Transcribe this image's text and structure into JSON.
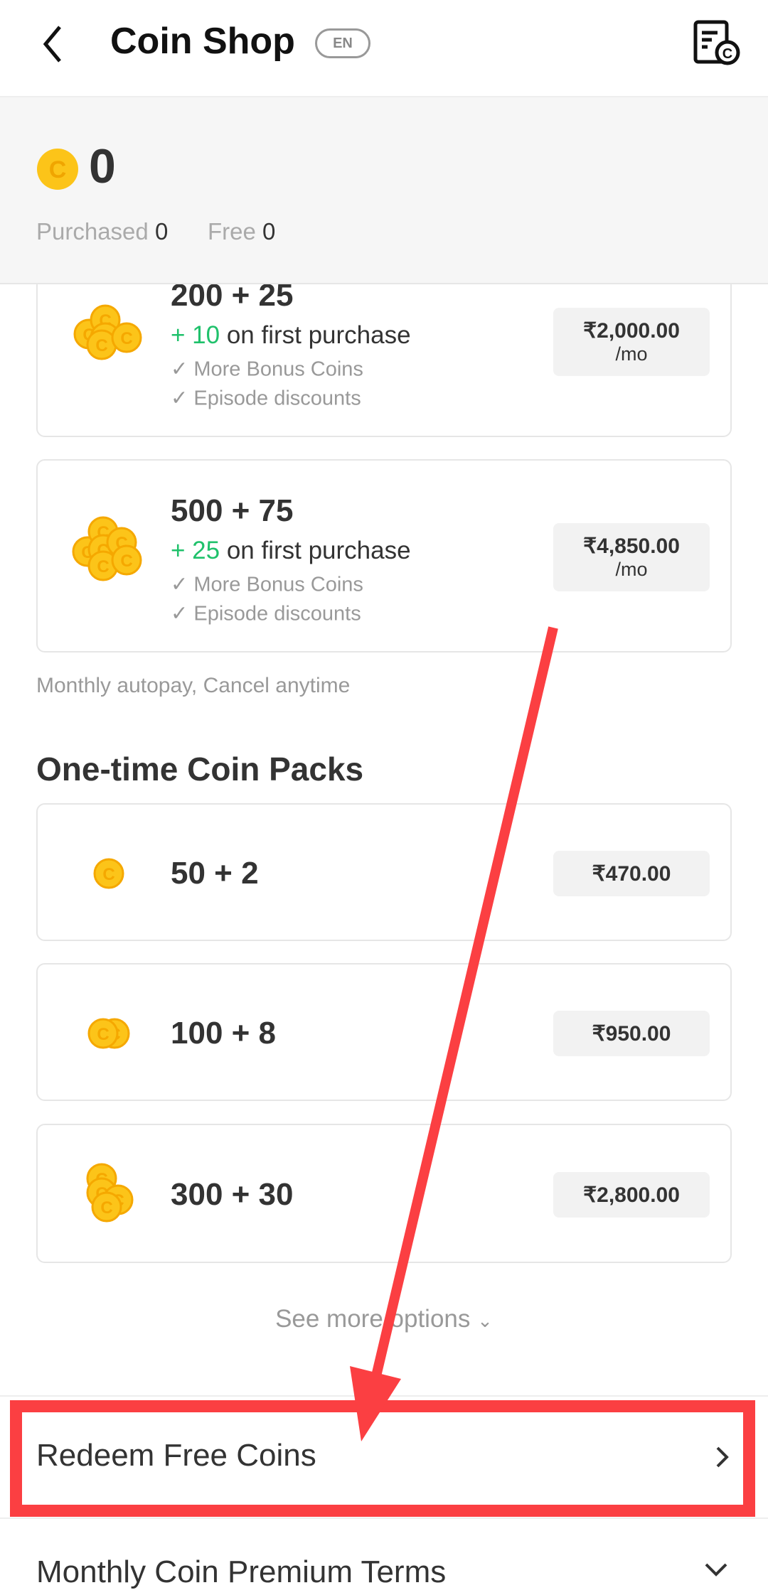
{
  "header": {
    "title": "Coin Shop",
    "language_badge": "EN",
    "back_icon": "chevron-left-icon",
    "history_icon": "coin-receipt-icon"
  },
  "balance": {
    "total": "0",
    "purchased_label": "Purchased",
    "purchased": "0",
    "free_label": "Free",
    "free": "0"
  },
  "subscriptions": [
    {
      "title": "200 + 25",
      "bonus_prefix": "+ 10",
      "bonus_suffix": " on first purchase",
      "perks": [
        "More Bonus Coins",
        "Episode discounts"
      ],
      "price": "₹2,000.00",
      "period": "/mo"
    },
    {
      "title": "500 + 75",
      "bonus_prefix": "+ 25",
      "bonus_suffix": " on first purchase",
      "perks": [
        "More Bonus Coins",
        "Episode discounts"
      ],
      "price": "₹4,850.00",
      "period": "/mo"
    }
  ],
  "autopay_note": "Monthly autopay, Cancel anytime",
  "one_time": {
    "heading": "One-time Coin Packs",
    "packs": [
      {
        "title": "50 + 2",
        "price": "₹470.00"
      },
      {
        "title": "100 + 8",
        "price": "₹950.00"
      },
      {
        "title": "300 + 30",
        "price": "₹2,800.00"
      }
    ]
  },
  "see_more": "See more options",
  "redeem": "Redeem Free Coins",
  "terms": "Monthly Coin Premium Terms",
  "colors": {
    "accent_green": "#1fc16b",
    "coin_gold": "#fcc419",
    "annotation_red": "#fb3f42"
  }
}
